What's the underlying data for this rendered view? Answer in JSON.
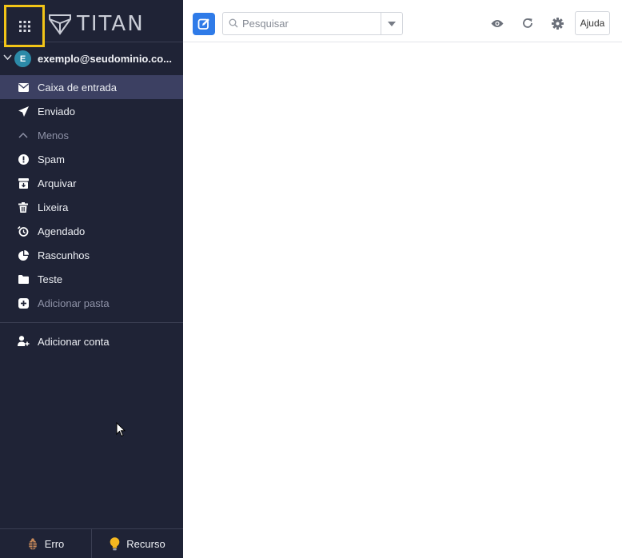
{
  "brand": {
    "name": "TITAN"
  },
  "account": {
    "avatar_letter": "E",
    "email": "exemplo@seudominio.co..."
  },
  "folders": [
    {
      "label": "Caixa de entrada",
      "icon": "envelope-icon",
      "active": true
    },
    {
      "label": "Enviado",
      "icon": "paper-plane-icon"
    },
    {
      "label": "Menos",
      "icon": "chevron-up-icon",
      "muted": true
    },
    {
      "label": "Spam",
      "icon": "exclamation-circle-icon"
    },
    {
      "label": "Arquivar",
      "icon": "archive-icon"
    },
    {
      "label": "Lixeira",
      "icon": "trash-icon"
    },
    {
      "label": "Agendado",
      "icon": "clock-icon"
    },
    {
      "label": "Rascunhos",
      "icon": "pie-icon"
    },
    {
      "label": "Teste",
      "icon": "folder-icon"
    },
    {
      "label": "Adicionar pasta",
      "icon": "plus-square-icon",
      "muted": true
    }
  ],
  "add_account": {
    "label": "Adicionar conta",
    "icon": "user-plus-icon"
  },
  "footer": {
    "bug_label": "Erro",
    "feature_label": "Recurso"
  },
  "toolbar": {
    "search_placeholder": "Pesquisar",
    "help_label": "Ajuda"
  },
  "colors": {
    "sidebar_bg": "#1f2336",
    "active_bg": "#3c4062",
    "accent": "#2f7be8",
    "highlight": "#f2c417"
  }
}
